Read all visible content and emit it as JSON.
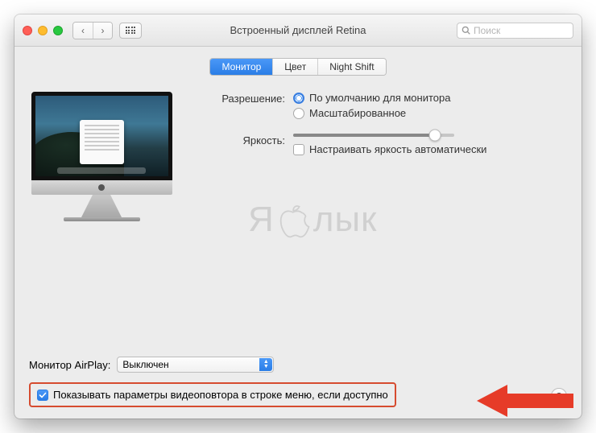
{
  "window": {
    "title": "Встроенный дисплей Retina"
  },
  "search": {
    "placeholder": "Поиск"
  },
  "tabs": {
    "monitor": "Монитор",
    "color": "Цвет",
    "night_shift": "Night Shift"
  },
  "settings": {
    "resolution_label": "Разрешение:",
    "resolution_default": "По умолчанию для монитора",
    "resolution_scaled": "Масштабированное",
    "brightness_label": "Яркость:",
    "auto_brightness": "Настраивать яркость автоматически"
  },
  "watermark": {
    "left": "Я",
    "right": "лык"
  },
  "footer": {
    "airplay_label": "Монитор AirPlay:",
    "airplay_value": "Выключен",
    "show_mirroring": "Показывать параметры видеоповтора в строке меню, если доступно",
    "help": "?"
  }
}
